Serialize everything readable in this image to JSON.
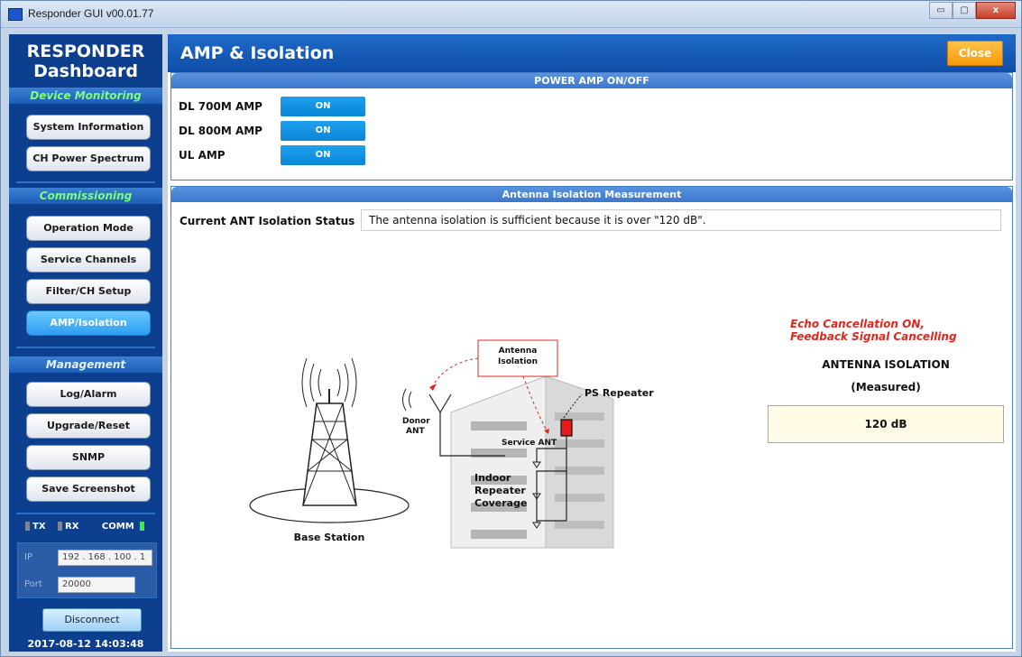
{
  "window": {
    "title": "Responder GUI v00.01.77",
    "controls": {
      "minimize": "▭",
      "maximize": "▢",
      "close": "x"
    }
  },
  "sidebar": {
    "brand_line1": "RESPONDER",
    "brand_line2": "Dashboard",
    "sections": {
      "monitoring": "Device Monitoring",
      "commissioning": "Commissioning",
      "management": "Management"
    },
    "buttons": {
      "system_information": "System Information",
      "ch_power_spectrum": "CH Power Spectrum",
      "operation_mode": "Operation Mode",
      "service_channels": "Service Channels",
      "filter_ch_setup": "Filter/CH Setup",
      "amp_isolation": "AMP/Isolation",
      "log_alarm": "Log/Alarm",
      "upgrade_reset": "Upgrade/Reset",
      "snmp": "SNMP",
      "save_screenshot": "Save Screenshot"
    },
    "status": {
      "tx": "TX",
      "rx": "RX",
      "comm": "COMM"
    },
    "connection": {
      "ip_label": "IP",
      "ip_value": "192 . 168 . 100 .  1",
      "port_label": "Port",
      "port_value": "20000"
    },
    "disconnect_label": "Disconnect",
    "datetime": "2017-08-12 14:03:48"
  },
  "main": {
    "title": "AMP & Isolation",
    "close_label": "Close",
    "power_amp": {
      "header": "POWER AMP ON/OFF",
      "rows": [
        {
          "label": "DL 700M AMP",
          "state": "ON"
        },
        {
          "label": "DL 800M AMP",
          "state": "ON"
        },
        {
          "label": "UL AMP",
          "state": "ON"
        }
      ]
    },
    "isolation": {
      "header": "Antenna Isolation Measurement",
      "status_label": "Current ANT Isolation Status",
      "status_value": "The antenna isolation is sufficient because it is over \"120 dB\".",
      "echo_line1": "Echo Cancellation ON,",
      "echo_line2": "Feedback Signal Cancelling",
      "measure_title": "ANTENNA ISOLATION",
      "measure_sub": "(Measured)",
      "measure_value": "120 dB",
      "diagram": {
        "base_station": "Base Station",
        "antenna_isolation_1": "Antenna",
        "antenna_isolation_2": "Isolation",
        "ps_repeater": "PS Repeater",
        "donor_ant_1": "Donor",
        "donor_ant_2": "ANT",
        "service_ant": "Service ANT",
        "coverage_1": "Indoor",
        "coverage_2": "Repeater",
        "coverage_3": "Coverage"
      }
    }
  }
}
